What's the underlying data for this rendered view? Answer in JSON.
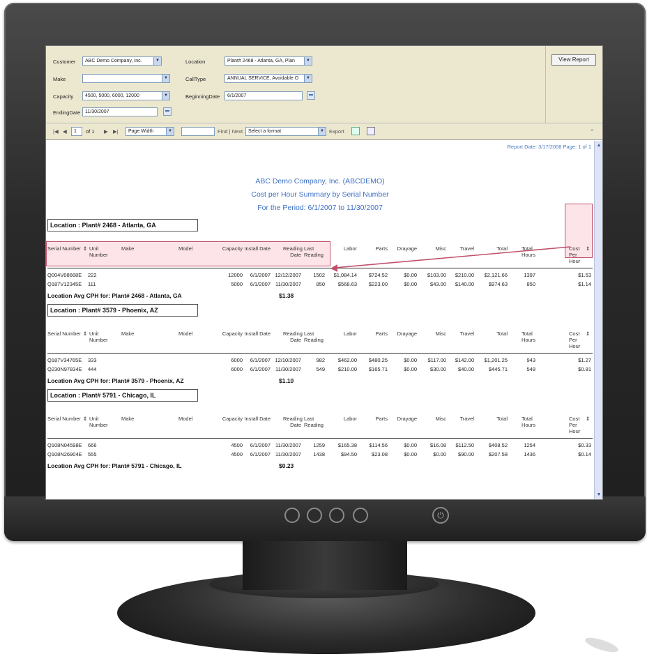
{
  "params": {
    "customer_label": "Customer",
    "customer_value": "ABC Demo Company, Inc.",
    "make_label": "Make",
    "make_value": "",
    "capacity_label": "Capacity",
    "capacity_value": "4500, 5000, 6000, 12000",
    "ending_label": "EndingDate",
    "ending_value": "11/30/2007",
    "location_label": "Location",
    "location_value": "Plant# 2468 - Atlanta, GA, Plan",
    "calltype_label": "CallType",
    "calltype_value": "ANNUAL SERVICE, Avoidable O",
    "beginning_label": "BeginningDate",
    "beginning_value": "6/1/2007",
    "view_report": "View Report"
  },
  "toolbar": {
    "page_value": "1",
    "page_of": "of 1",
    "zoom": "Page Width",
    "find_label": "Find | Next",
    "format": "Select a format",
    "export": "Export"
  },
  "report": {
    "report_date": "Report Date: 3/17/2008 Page: 1 of 1",
    "title1": "ABC Demo Company, Inc. (ABCDEMO)",
    "title2": "Cost per Hour Summary by Serial Number",
    "title3": "For the Period: 6/1/2007 to 11/30/2007",
    "headers": {
      "serial": "Serial Number",
      "unit": "Unit Number",
      "make": "Make",
      "model": "Model",
      "capacity": "Capacity",
      "install": "Install Date",
      "reading": "Reading Date",
      "last": "Last Reading",
      "labor": "Labor",
      "parts": "Parts",
      "drayage": "Drayage",
      "misc": "Misc",
      "travel": "Travel",
      "total": "Total",
      "hours": "Total Hours",
      "cph": "Cost Per Hour"
    },
    "groups": [
      {
        "location": "Location : Plant# 2468 - Atlanta, GA",
        "avg_label": "Location Avg CPH for: Plant# 2468 - Atlanta, GA",
        "avg_value": "$1.38",
        "rows": [
          {
            "serial": "Q004V08668E",
            "unit": "222",
            "capacity": "12000",
            "install": "6/1/2007",
            "reading": "12/12/2007",
            "last": "1502",
            "labor": "$1,084.14",
            "parts": "$724.52",
            "drayage": "$0.00",
            "misc": "$103.00",
            "travel": "$210.00",
            "total": "$2,121.66",
            "hours": "1397",
            "cph": "$1.53"
          },
          {
            "serial": "Q187V12345E",
            "unit": "111",
            "capacity": "5000",
            "install": "6/1/2007",
            "reading": "11/30/2007",
            "last": "850",
            "labor": "$568.63",
            "parts": "$223.00",
            "drayage": "$0.00",
            "misc": "$43.00",
            "travel": "$140.00",
            "total": "$974.63",
            "hours": "850",
            "cph": "$1.14"
          }
        ]
      },
      {
        "location": "Location : Plant# 3579 - Phoenix, AZ",
        "avg_label": "Location Avg CPH for: Plant# 3579 - Phoenix, AZ",
        "avg_value": "$1.10",
        "rows": [
          {
            "serial": "Q187V34765E",
            "unit": "333",
            "capacity": "6000",
            "install": "6/1/2007",
            "reading": "12/10/2007",
            "last": "982",
            "labor": "$462.00",
            "parts": "$480.25",
            "drayage": "$0.00",
            "misc": "$117.00",
            "travel": "$142.00",
            "total": "$1,201.25",
            "hours": "943",
            "cph": "$1.27"
          },
          {
            "serial": "Q230N97834E",
            "unit": "444",
            "capacity": "6000",
            "install": "6/1/2007",
            "reading": "11/30/2007",
            "last": "549",
            "labor": "$210.00",
            "parts": "$165.71",
            "drayage": "$0.00",
            "misc": "$30.00",
            "travel": "$40.00",
            "total": "$445.71",
            "hours": "548",
            "cph": "$0.81"
          }
        ]
      },
      {
        "location": "Location : Plant# 5791 - Chicago, IL",
        "avg_label": "Location Avg CPH for: Plant# 5791 - Chicago, IL",
        "avg_value": "$0.23",
        "rows": [
          {
            "serial": "Q108N04598E",
            "unit": "666",
            "capacity": "4500",
            "install": "6/1/2007",
            "reading": "11/30/2007",
            "last": "1259",
            "labor": "$165.38",
            "parts": "$114.56",
            "drayage": "$0.00",
            "misc": "$16.08",
            "travel": "$112.50",
            "total": "$408.52",
            "hours": "1254",
            "cph": "$0.33"
          },
          {
            "serial": "Q108N26904E",
            "unit": "555",
            "capacity": "4500",
            "install": "6/1/2007",
            "reading": "11/30/2007",
            "last": "1438",
            "labor": "$94.50",
            "parts": "$23.08",
            "drayage": "$0.00",
            "misc": "$0.00",
            "travel": "$90.00",
            "total": "$207.58",
            "hours": "1436",
            "cph": "$0.14"
          }
        ]
      }
    ]
  }
}
